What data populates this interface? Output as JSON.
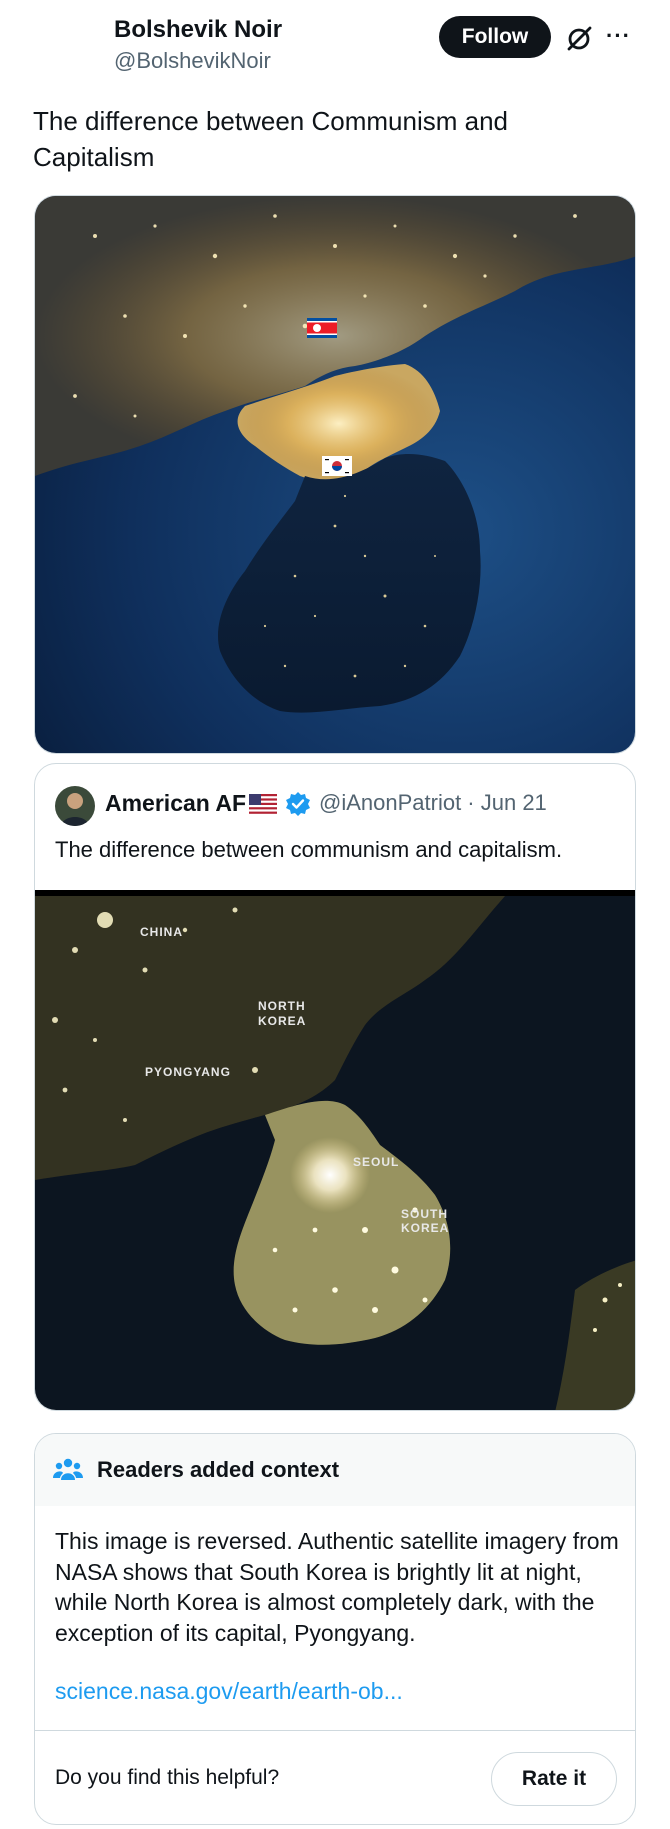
{
  "post": {
    "author_name": "Bolshevik Noir",
    "author_handle": "@BolshevikNoir",
    "follow_label": "Follow",
    "more_label": "···",
    "text": "The difference between Communism and Capitalism"
  },
  "quote": {
    "author_name": "American AF",
    "handle_date": "@iAnonPatriot · Jun 21",
    "text": "The difference between communism and capitalism.",
    "map_labels": {
      "china": "CHINA",
      "north_korea_1": "NORTH",
      "north_korea_2": "KOREA",
      "pyongyang": "PYONGYANG",
      "seoul": "SEOUL",
      "south_korea_1": "SOUTH",
      "south_korea_2": "KOREA"
    }
  },
  "community_note": {
    "title": "Readers added context",
    "body": "This image is reversed. Authentic satellite imagery from NASA shows that South Korea is brightly lit at night, while North Korea is almost completely dark, with the exception of its capital, Pyongyang.",
    "link": "science.nasa.gov/earth/earth-ob...",
    "helpful_question": "Do you find this helpful?",
    "rate_label": "Rate it"
  },
  "colors": {
    "text_primary": "#0f1419",
    "text_secondary": "#536471",
    "link": "#1d9bf0",
    "verified": "#1d9bf0",
    "border": "#cfd9de"
  },
  "icons": [
    "grok-icon",
    "more-icon",
    "verified-badge-icon",
    "us-flag-icon",
    "readers-context-icon"
  ]
}
